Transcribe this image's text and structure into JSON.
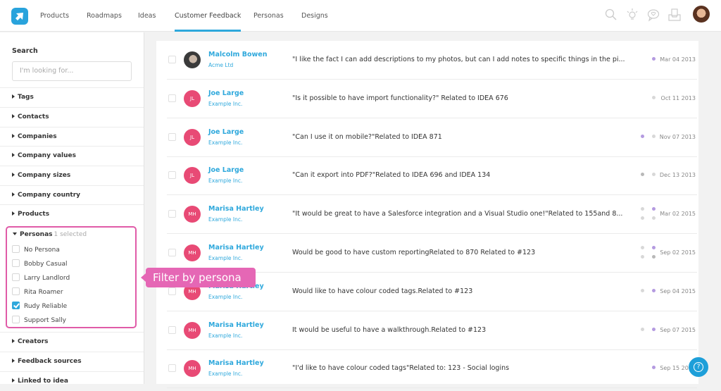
{
  "nav": {
    "items": [
      {
        "label": "Products",
        "active": false
      },
      {
        "label": "Roadmaps",
        "active": false
      },
      {
        "label": "Ideas",
        "active": false
      },
      {
        "label": "Customer Feedback",
        "active": true
      },
      {
        "label": "Personas",
        "active": false
      },
      {
        "label": "Designs",
        "active": false
      }
    ],
    "icons": [
      "search-icon",
      "lightbulb-icon",
      "chat-heart-icon",
      "inbox-icon"
    ]
  },
  "sidebar": {
    "search_label": "Search",
    "search_placeholder": "I'm looking for...",
    "filters_top": [
      "Tags",
      "Contacts",
      "Companies",
      "Company values",
      "Company sizes",
      "Company country",
      "Products"
    ],
    "personas": {
      "label": "Personas",
      "sublabel": "1 selected",
      "options": [
        {
          "label": "No Persona",
          "checked": false
        },
        {
          "label": "Bobby Casual",
          "checked": false
        },
        {
          "label": "Larry Landlord",
          "checked": false
        },
        {
          "label": "Rita Roamer",
          "checked": false
        },
        {
          "label": "Rudy Reliable",
          "checked": true
        },
        {
          "label": "Support Sally",
          "checked": false
        }
      ]
    },
    "filters_bottom": [
      "Creators",
      "Feedback sources",
      "Linked to idea"
    ]
  },
  "callout": {
    "text": "Filter by persona"
  },
  "colors": {
    "accent": "#2ea8dc",
    "callout": "#e567b5",
    "avatar": "#e84a75",
    "dot_purple": "#b49ae0",
    "dot_gray": "#d8d8d8",
    "dot_dark": "#b8b8b8"
  },
  "feedback": [
    {
      "name": "Malcolm Bowen",
      "company": "Acme Ltd",
      "initials": "",
      "photo": true,
      "text": "\"I like the fact I can add descriptions to my photos, but can I add notes to specific things in the pi...",
      "date": "Mar 04 2013",
      "dots": [
        [
          "purple"
        ]
      ]
    },
    {
      "name": "Joe Large",
      "company": "Example Inc.",
      "initials": "JL",
      "photo": false,
      "text": "\"Is it possible to have import functionality?\" Related to IDEA 676",
      "date": "Oct 11 2013",
      "dots": [
        [
          "gray"
        ]
      ]
    },
    {
      "name": "Joe Large",
      "company": "Example Inc.",
      "initials": "JL",
      "photo": false,
      "text": "\"Can I use it on mobile?\"Related to IDEA 871",
      "date": "Nov 07 2013",
      "dots": [
        [
          "purple",
          "gray"
        ]
      ]
    },
    {
      "name": "Joe Large",
      "company": "Example Inc.",
      "initials": "JL",
      "photo": false,
      "text": "\"Can it export into PDF?\"Related to IDEA 696 and IDEA 134",
      "date": "Dec 13 2013",
      "dots": [
        [
          "dark",
          "gray"
        ]
      ]
    },
    {
      "name": "Marisa Hartley",
      "company": "Example Inc.",
      "initials": "MH",
      "photo": false,
      "text": "\"It would be great to have a Salesforce integration and a Visual Studio one!\"Related to 155and 8...",
      "date": "Mar 02 2015",
      "dots": [
        [
          "gray",
          "purple"
        ],
        [
          "gray",
          "gray"
        ]
      ]
    },
    {
      "name": "Marisa Hartley",
      "company": "Example Inc.",
      "initials": "MH",
      "photo": false,
      "text": "Would be good to have custom reportingRelated to 870 Related to #123",
      "date": "Sep 02 2015",
      "dots": [
        [
          "gray",
          "purple"
        ],
        [
          "gray",
          "dark"
        ]
      ]
    },
    {
      "name": "Marisa Hartley",
      "company": "Example Inc.",
      "initials": "MH",
      "photo": false,
      "text": "Would like to have colour coded tags.Related to #123",
      "date": "Sep 04 2015",
      "dots": [
        [
          "gray",
          "purple"
        ]
      ]
    },
    {
      "name": "Marisa Hartley",
      "company": "Example Inc.",
      "initials": "MH",
      "photo": false,
      "text": "It would be useful to have a walkthrough.Related to #123",
      "date": "Sep 07 2015",
      "dots": [
        [
          "gray",
          "purple"
        ]
      ]
    },
    {
      "name": "Marisa Hartley",
      "company": "Example Inc.",
      "initials": "MH",
      "photo": false,
      "text": "\"I'd like to have colour coded tags\"Related to: 123 - Social logins",
      "date": "Sep 15 2015",
      "dots": [
        [
          "purple"
        ]
      ]
    }
  ],
  "help_button": {
    "label": "?"
  }
}
